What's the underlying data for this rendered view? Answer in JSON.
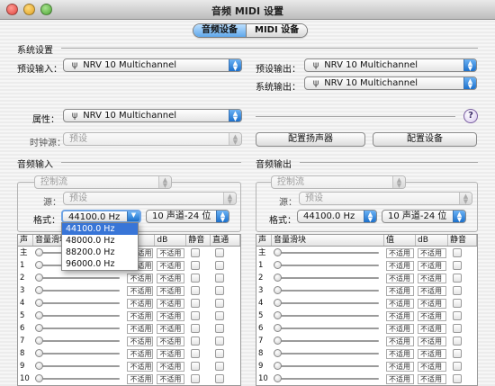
{
  "window": {
    "title": "音频 MIDI 设置"
  },
  "tabs": [
    {
      "label": "音频设备",
      "active": true
    },
    {
      "label": "MIDI 设备",
      "active": false
    }
  ],
  "system": {
    "section_label": "系统设置",
    "default_input_label": "预设输入：",
    "default_input_value": "NRV 10 Multichannel",
    "default_output_label": "预设输出：",
    "default_output_value": "NRV 10 Multichannel",
    "system_output_label": "系统输出：",
    "system_output_value": "NRV 10 Multichannel"
  },
  "device": {
    "properties_label": "属性：",
    "properties_value": "NRV 10 Multichannel",
    "help": "?",
    "clock_label": "时钟源：",
    "clock_value": "预设",
    "configure_speakers": "配置扬声器",
    "configure_device": "配置设备"
  },
  "audio_input": {
    "section_label": "音频输入",
    "stream_value": "控制流",
    "source_label": "源：",
    "source_value": "预设",
    "format_label": "格式：",
    "format_value": "44100.0 Hz",
    "channels_value": "10 声道-24 位",
    "format_menu": [
      "44100.0 Hz",
      "48000.0 Hz",
      "88200.0 Hz",
      "96000.0 Hz"
    ],
    "columns": [
      "声",
      "音量滑块",
      "值",
      "dB",
      "静音",
      "直通"
    ],
    "rows": [
      "主",
      "1",
      "2",
      "3",
      "4",
      "5",
      "6",
      "7",
      "8",
      "9",
      "10"
    ]
  },
  "audio_output": {
    "section_label": "音频输出",
    "stream_value": "控制流",
    "source_label": "源：",
    "source_value": "预设",
    "format_label": "格式：",
    "format_value": "44100.0 Hz",
    "channels_value": "10 声道-24 位",
    "columns": [
      "声",
      "音量滑块",
      "值",
      "dB",
      "静音"
    ],
    "rows": [
      "主",
      "1",
      "2",
      "3",
      "4",
      "5",
      "6",
      "7",
      "8",
      "9",
      "10"
    ]
  },
  "cell_na": "不适用",
  "colors": {
    "accent": "#3875d7",
    "tab_active": "#5fa7ea",
    "close": "#e0443e",
    "minimize": "#dea123",
    "zoom": "#4ea634"
  }
}
